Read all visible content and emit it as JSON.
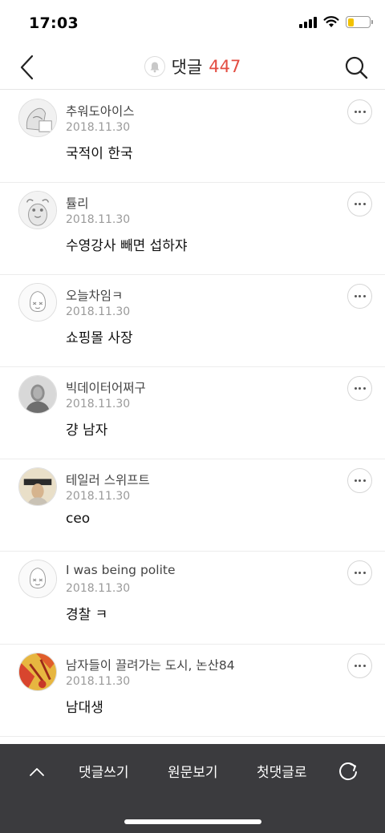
{
  "status_bar": {
    "time": "17:03",
    "battery_color": "#f2c200"
  },
  "nav": {
    "title": "댓글",
    "count": "447",
    "count_color": "#e34d42",
    "back_icon": "chevron-left-icon",
    "search_icon": "search-icon",
    "bell_icon": "bell-icon"
  },
  "comments": [
    {
      "author": "추워도아이스",
      "date": "2018.11.30",
      "text": "국적이 한국"
    },
    {
      "author": "튤리",
      "date": "2018.11.30",
      "text": "수영강사 빼면 섭하쟈"
    },
    {
      "author": "오늘차임ㅋ",
      "date": "2018.11.30",
      "text": "쇼핑몰 사장"
    },
    {
      "author": "빅데이터어쩌구",
      "date": "2018.11.30",
      "text": "걍 남자"
    },
    {
      "author": "테일러 스위프트",
      "date": "2018.11.30",
      "text": "ceo"
    },
    {
      "author": "I was being polite",
      "date": "2018.11.30",
      "text": "경찰 ㅋ"
    },
    {
      "author": "남자들이 끌려가는 도시, 논산84",
      "date": "2018.11.30",
      "text": "남대생"
    }
  ],
  "bottom_bar": {
    "write": "댓글쓰기",
    "original": "원문보기",
    "first": "첫댓글로",
    "up_icon": "chevron-up-icon",
    "refresh_icon": "refresh-icon"
  }
}
